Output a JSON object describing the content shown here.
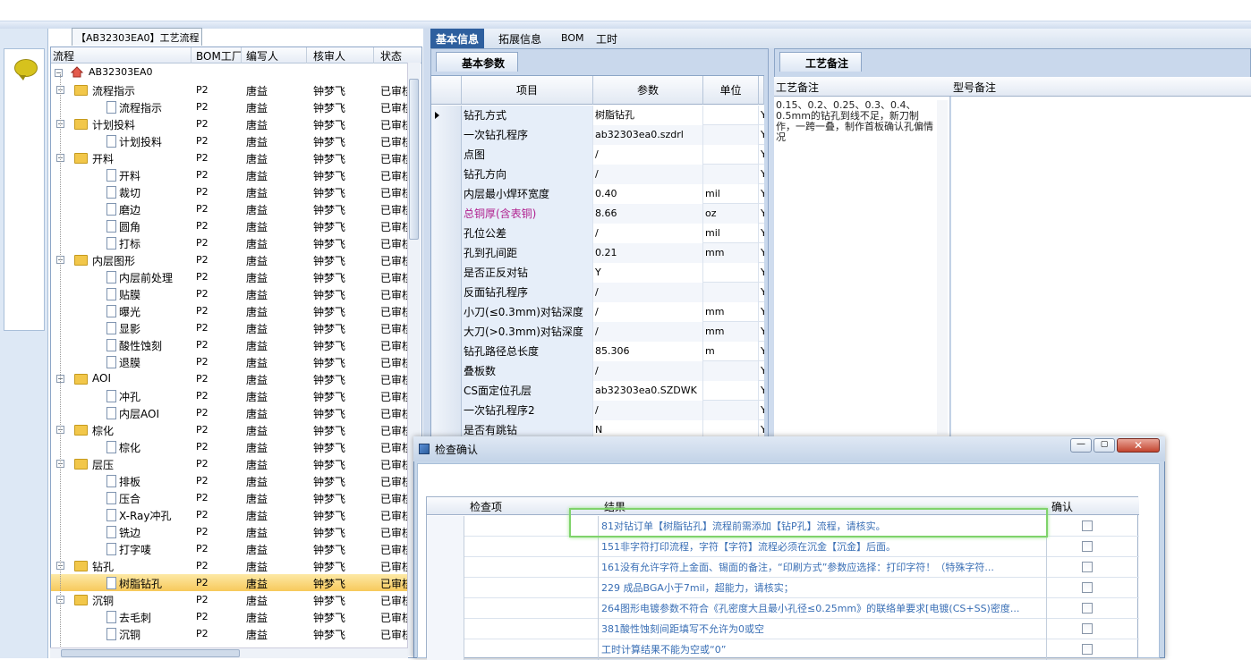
{
  "left_panel_tab": "【AB32303EA0】工艺流程",
  "tree": {
    "headers": [
      "流程",
      "BOM工厂",
      "编写人",
      "核审人",
      "状态"
    ],
    "root": "AB32303EA0",
    "rows": [
      {
        "label": "流程指示",
        "level": 1,
        "folder": true,
        "factory": "P2",
        "writer": "唐益",
        "reviewer": "钟梦飞",
        "status": "已审核"
      },
      {
        "label": "流程指示",
        "level": 2,
        "folder": false,
        "factory": "P2",
        "writer": "唐益",
        "reviewer": "钟梦飞",
        "status": "已审核"
      },
      {
        "label": "计划投料",
        "level": 1,
        "folder": true,
        "factory": "P2",
        "writer": "唐益",
        "reviewer": "钟梦飞",
        "status": "已审核"
      },
      {
        "label": "计划投料",
        "level": 2,
        "folder": false,
        "factory": "P2",
        "writer": "唐益",
        "reviewer": "钟梦飞",
        "status": "已审核"
      },
      {
        "label": "开料",
        "level": 1,
        "folder": true,
        "factory": "P2",
        "writer": "唐益",
        "reviewer": "钟梦飞",
        "status": "已审核"
      },
      {
        "label": "开料",
        "level": 2,
        "folder": false,
        "factory": "P2",
        "writer": "唐益",
        "reviewer": "钟梦飞",
        "status": "已审核"
      },
      {
        "label": "裁切",
        "level": 2,
        "folder": false,
        "factory": "P2",
        "writer": "唐益",
        "reviewer": "钟梦飞",
        "status": "已审核"
      },
      {
        "label": "磨边",
        "level": 2,
        "folder": false,
        "factory": "P2",
        "writer": "唐益",
        "reviewer": "钟梦飞",
        "status": "已审核"
      },
      {
        "label": "圆角",
        "level": 2,
        "folder": false,
        "factory": "P2",
        "writer": "唐益",
        "reviewer": "钟梦飞",
        "status": "已审核"
      },
      {
        "label": "打标",
        "level": 2,
        "folder": false,
        "factory": "P2",
        "writer": "唐益",
        "reviewer": "钟梦飞",
        "status": "已审核"
      },
      {
        "label": "内层图形",
        "level": 1,
        "folder": true,
        "factory": "P2",
        "writer": "唐益",
        "reviewer": "钟梦飞",
        "status": "已审核"
      },
      {
        "label": "内层前处理",
        "level": 2,
        "folder": false,
        "factory": "P2",
        "writer": "唐益",
        "reviewer": "钟梦飞",
        "status": "已审核"
      },
      {
        "label": "贴膜",
        "level": 2,
        "folder": false,
        "factory": "P2",
        "writer": "唐益",
        "reviewer": "钟梦飞",
        "status": "已审核"
      },
      {
        "label": "曝光",
        "level": 2,
        "folder": false,
        "factory": "P2",
        "writer": "唐益",
        "reviewer": "钟梦飞",
        "status": "已审核"
      },
      {
        "label": "显影",
        "level": 2,
        "folder": false,
        "factory": "P2",
        "writer": "唐益",
        "reviewer": "钟梦飞",
        "status": "已审核"
      },
      {
        "label": "酸性蚀刻",
        "level": 2,
        "folder": false,
        "factory": "P2",
        "writer": "唐益",
        "reviewer": "钟梦飞",
        "status": "已审核"
      },
      {
        "label": "退膜",
        "level": 2,
        "folder": false,
        "factory": "P2",
        "writer": "唐益",
        "reviewer": "钟梦飞",
        "status": "已审核"
      },
      {
        "label": "AOI",
        "level": 1,
        "folder": true,
        "factory": "P2",
        "writer": "唐益",
        "reviewer": "钟梦飞",
        "status": "已审核"
      },
      {
        "label": "冲孔",
        "level": 2,
        "folder": false,
        "factory": "P2",
        "writer": "唐益",
        "reviewer": "钟梦飞",
        "status": "已审核"
      },
      {
        "label": "内层AOI",
        "level": 2,
        "folder": false,
        "factory": "P2",
        "writer": "唐益",
        "reviewer": "钟梦飞",
        "status": "已审核"
      },
      {
        "label": "棕化",
        "level": 1,
        "folder": true,
        "factory": "P2",
        "writer": "唐益",
        "reviewer": "钟梦飞",
        "status": "已审核"
      },
      {
        "label": "棕化",
        "level": 2,
        "folder": false,
        "factory": "P2",
        "writer": "唐益",
        "reviewer": "钟梦飞",
        "status": "已审核"
      },
      {
        "label": "层压",
        "level": 1,
        "folder": true,
        "factory": "P2",
        "writer": "唐益",
        "reviewer": "钟梦飞",
        "status": "已审核"
      },
      {
        "label": "排板",
        "level": 2,
        "folder": false,
        "factory": "P2",
        "writer": "唐益",
        "reviewer": "钟梦飞",
        "status": "已审核"
      },
      {
        "label": "压合",
        "level": 2,
        "folder": false,
        "factory": "P2",
        "writer": "唐益",
        "reviewer": "钟梦飞",
        "status": "已审核"
      },
      {
        "label": "X-Ray冲孔",
        "level": 2,
        "folder": false,
        "factory": "P2",
        "writer": "唐益",
        "reviewer": "钟梦飞",
        "status": "已审核"
      },
      {
        "label": "铣边",
        "level": 2,
        "folder": false,
        "factory": "P2",
        "writer": "唐益",
        "reviewer": "钟梦飞",
        "status": "已审核"
      },
      {
        "label": "打字唛",
        "level": 2,
        "folder": false,
        "factory": "P2",
        "writer": "唐益",
        "reviewer": "钟梦飞",
        "status": "已审核"
      },
      {
        "label": "钻孔",
        "level": 1,
        "folder": true,
        "factory": "P2",
        "writer": "唐益",
        "reviewer": "钟梦飞",
        "status": "已审核"
      },
      {
        "label": "树脂钻孔",
        "level": 2,
        "folder": false,
        "factory": "P2",
        "writer": "唐益",
        "reviewer": "钟梦飞",
        "status": "已审核",
        "selected": true
      },
      {
        "label": "沉铜",
        "level": 1,
        "folder": true,
        "factory": "P2",
        "writer": "唐益",
        "reviewer": "钟梦飞",
        "status": "已审核"
      },
      {
        "label": "去毛刺",
        "level": 2,
        "folder": false,
        "factory": "P2",
        "writer": "唐益",
        "reviewer": "钟梦飞",
        "status": "已审核"
      },
      {
        "label": "沉铜",
        "level": 2,
        "folder": false,
        "factory": "P2",
        "writer": "唐益",
        "reviewer": "钟梦飞",
        "status": "已审核"
      }
    ]
  },
  "right_tabs": [
    "基本信息",
    "拓展信息",
    "BOM",
    "工时"
  ],
  "basic_params": {
    "tab": "基本参数",
    "headers": [
      "项目",
      "参数",
      "单位"
    ],
    "rows": [
      {
        "item": "钻孔方式",
        "value": "树脂钻孔",
        "unit": "",
        "flag": "Y"
      },
      {
        "item": "一次钻孔程序",
        "value": "ab32303ea0.szdrl",
        "unit": "",
        "flag": "Y"
      },
      {
        "item": "点图",
        "value": "/",
        "unit": "",
        "flag": "Y"
      },
      {
        "item": "钻孔方向",
        "value": "/",
        "unit": "",
        "flag": "Y"
      },
      {
        "item": "内层最小焊环宽度",
        "value": "0.40",
        "unit": "mil",
        "flag": "Y"
      },
      {
        "item": "总铜厚(含表铜)",
        "value": "8.66",
        "unit": "oz",
        "flag": "Y",
        "highlight": true
      },
      {
        "item": "孔位公差",
        "value": "/",
        "unit": "mil",
        "flag": "Y"
      },
      {
        "item": "孔到孔间距",
        "value": "0.21",
        "unit": "mm",
        "flag": "Y"
      },
      {
        "item": "是否正反对钻",
        "value": "Y",
        "unit": "",
        "flag": "Y"
      },
      {
        "item": "反面钻孔程序",
        "value": "/",
        "unit": "",
        "flag": "Y"
      },
      {
        "item": "小刀(≤0.3mm)对钻深度",
        "value": "/",
        "unit": "mm",
        "flag": "Y"
      },
      {
        "item": "大刀(>0.3mm)对钻深度",
        "value": "/",
        "unit": "mm",
        "flag": "Y"
      },
      {
        "item": "钻孔路径总长度",
        "value": "85.306",
        "unit": "m",
        "flag": "Y"
      },
      {
        "item": "叠板数",
        "value": "/",
        "unit": "",
        "flag": "Y"
      },
      {
        "item": "CS面定位孔层",
        "value": "ab32303ea0.SZDWK",
        "unit": "",
        "flag": "Y"
      },
      {
        "item": "一次钻孔程序2",
        "value": "/",
        "unit": "",
        "flag": "Y"
      },
      {
        "item": "是否有跳钻",
        "value": "N",
        "unit": "",
        "flag": "Y"
      }
    ]
  },
  "process_notes": {
    "tab": "工艺备注",
    "col1": "工艺备注",
    "col2": "型号备注",
    "text": "0.15、0.2、0.25、0.3、0.4、0.5mm的钻孔到线不足，新刀制作，一跨一叠，制作首板确认孔偏情况"
  },
  "dialog": {
    "title": "检查确认",
    "min": "—",
    "max": "▢",
    "close": "✕",
    "headers": [
      "检查项",
      "结果",
      "确认"
    ],
    "rows": [
      {
        "check": "",
        "result": "81对钻订单【树脂钻孔】流程前需添加【钻P孔】流程，请核实。",
        "confirmed": false
      },
      {
        "check": "",
        "result": "151非字符打印流程，字符【字符】流程必须在沉金【沉金】后面。",
        "confirmed": false
      },
      {
        "check": "",
        "result": "161没有允许字符上金面、锡面的备注，“印刷方式”参数应选择：打印字符！（特殊字符...",
        "confirmed": false
      },
      {
        "check": "",
        "result": "229 成品BGA小于7mil，超能力，请核实；",
        "confirmed": false
      },
      {
        "check": "",
        "result": "264图形电镀参数不符合《孔密度大且最小孔径≤0.25mm》的联络单要求[电镀(CS+SS)密度...",
        "confirmed": false
      },
      {
        "check": "",
        "result": "381酸性蚀刻间距填写不允许为0或空",
        "confirmed": false
      },
      {
        "check": "",
        "result": "工时计算结果不能为空或“0”",
        "confirmed": false
      }
    ]
  },
  "colors": {
    "accent": "#2e5f9e",
    "highlight_box": "#7fd36b",
    "link_text": "#3a6fb5",
    "magenta": "#b0208f"
  }
}
